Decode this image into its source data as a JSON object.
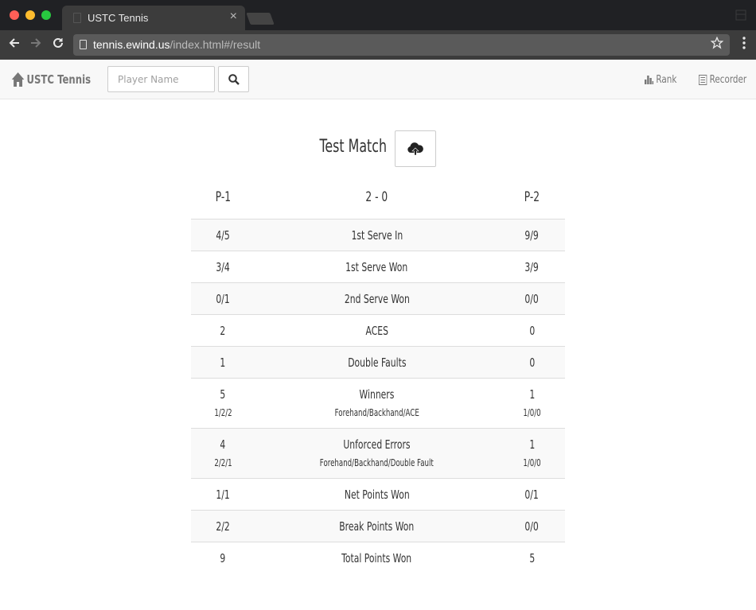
{
  "browser": {
    "tab_title": "USTC Tennis",
    "tab_close": "×",
    "url_host": "tennis.ewind.us",
    "url_path": "/index.html#/result"
  },
  "navbar": {
    "brand": "USTC Tennis",
    "search_placeholder": "Player Name",
    "rank_label": "Rank",
    "recorder_label": "Recorder"
  },
  "match": {
    "title": "Test Match",
    "player1": "P-1",
    "score": "2 - 0",
    "player2": "P-2"
  },
  "stats": [
    {
      "p1": "4/5",
      "label": "1st Serve In",
      "p2": "9/9"
    },
    {
      "p1": "3/4",
      "label": "1st Serve Won",
      "p2": "3/9"
    },
    {
      "p1": "0/1",
      "label": "2nd Serve Won",
      "p2": "0/0"
    },
    {
      "p1": "2",
      "label": "ACES",
      "p2": "0"
    },
    {
      "p1": "1",
      "label": "Double Faults",
      "p2": "0"
    },
    {
      "p1": "5",
      "label": "Winners",
      "p2": "1",
      "p1_sub": "1/2/2",
      "label_sub": "Forehand/Backhand/ACE",
      "p2_sub": "1/0/0"
    },
    {
      "p1": "4",
      "label": "Unforced Errors",
      "p2": "1",
      "p1_sub": "2/2/1",
      "label_sub": "Forehand/Backhand/Double Fault",
      "p2_sub": "1/0/0"
    },
    {
      "p1": "1/1",
      "label": "Net Points Won",
      "p2": "0/1"
    },
    {
      "p1": "2/2",
      "label": "Break Points Won",
      "p2": "0/0"
    },
    {
      "p1": "9",
      "label": "Total Points Won",
      "p2": "5"
    }
  ],
  "icons": {
    "brand": "home-icon",
    "search": "search-icon",
    "rank": "bar-chart-icon",
    "recorder": "list-icon",
    "upload": "cloud-upload-icon"
  }
}
